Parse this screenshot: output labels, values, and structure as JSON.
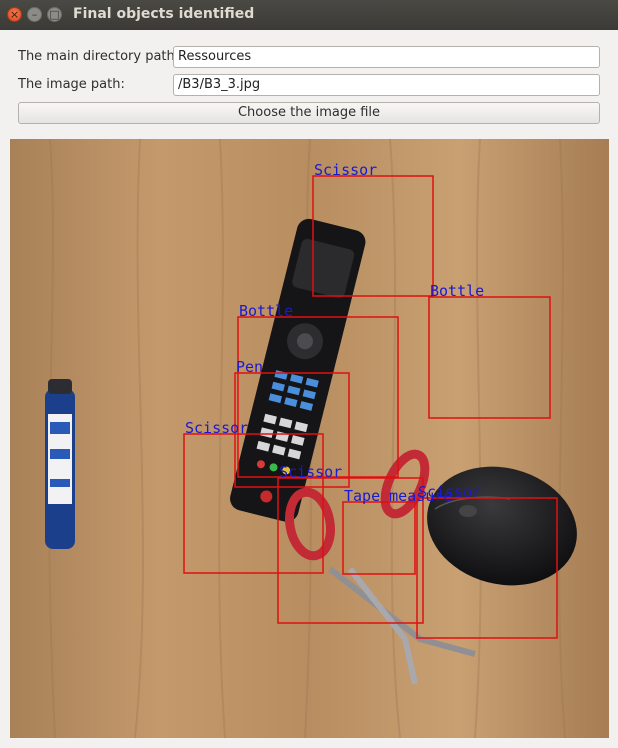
{
  "window": {
    "title": "Final objects identified",
    "close_glyph": "×",
    "min_glyph": "–",
    "max_glyph": "□"
  },
  "form": {
    "dir_label": "The main directory path:",
    "dir_value": "Ressources",
    "image_label": "The image path:",
    "image_value": "/B3/B3_3.jpg",
    "choose_button": "Choose the image file"
  },
  "detections": [
    "Scissor",
    "Bottle",
    "Bottle",
    "Pen",
    "Scissor",
    "Scissor",
    "Tape measure",
    "Scissor"
  ],
  "colors": {
    "box": "#e01010",
    "label": "#1a1ad0",
    "table": "#b98f62"
  }
}
